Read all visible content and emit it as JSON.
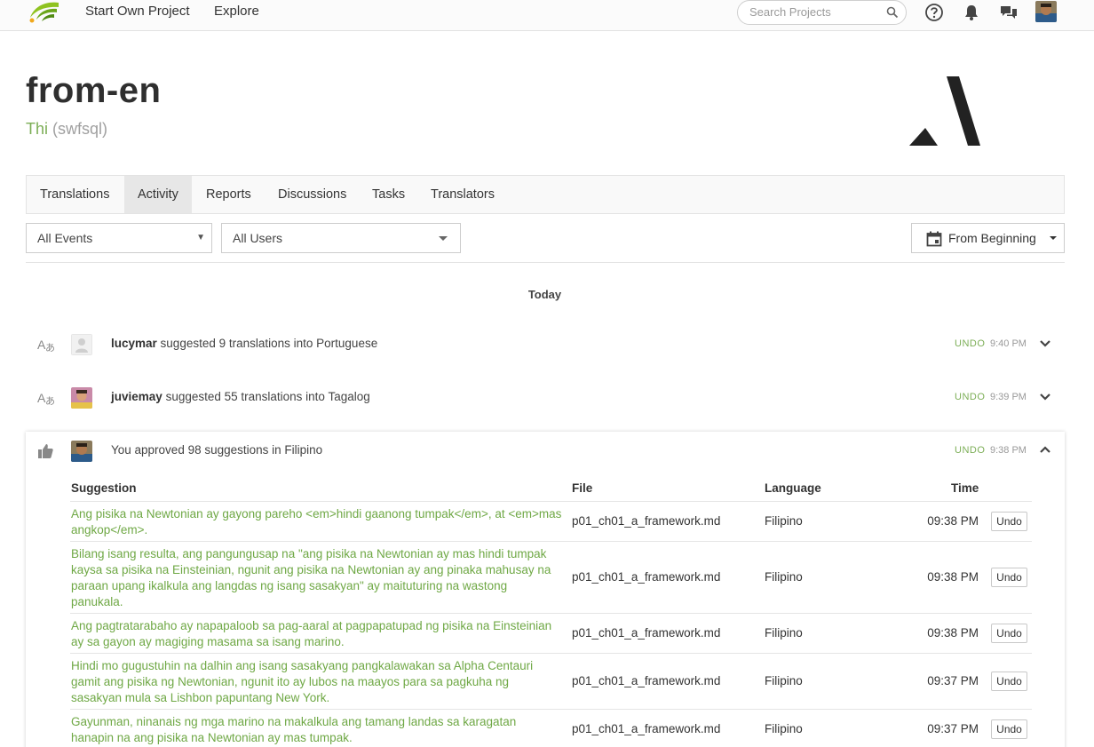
{
  "nav": {
    "links": [
      "Start Own Project",
      "Explore"
    ],
    "search_placeholder": "Search Projects",
    "icons": [
      "help-icon",
      "bell-icon",
      "messages-icon"
    ]
  },
  "project": {
    "title": "from-en",
    "owner_name": "Thi",
    "owner_handle": "(swfsql)"
  },
  "tabs": [
    "Translations",
    "Activity",
    "Reports",
    "Discussions",
    "Tasks",
    "Translators"
  ],
  "active_tab": "Activity",
  "filters": {
    "events": "All Events",
    "users": "All Users",
    "date": "From Beginning"
  },
  "day_label": "Today",
  "events": [
    {
      "user": "lucymar",
      "text": "suggested 9 translations into Portuguese",
      "undo": "UNDO",
      "time": "9:40 PM",
      "icon": "translate-icon"
    },
    {
      "user": "juviemay",
      "text": "suggested 55 translations into Tagalog",
      "undo": "UNDO",
      "time": "9:39 PM",
      "icon": "translate-icon"
    },
    {
      "user": "",
      "text": "You approved 98 suggestions in Filipino",
      "undo": "UNDO",
      "time": "9:38 PM",
      "icon": "thumbs-up-icon"
    }
  ],
  "table": {
    "headers": {
      "suggestion": "Suggestion",
      "file": "File",
      "language": "Language",
      "time": "Time"
    },
    "undo_label": "Undo",
    "rows": [
      {
        "suggestion": "Ang pisika na Newtonian ay gayong pareho <em>hindi gaanong tumpak</em>, at <em>mas angkop</em>.",
        "file": "p01_ch01_a_framework.md",
        "language": "Filipino",
        "time": "09:38 PM"
      },
      {
        "suggestion": "Bilang isang resulta, ang pangungusap na \"ang pisika na Newtonian ay mas hindi tumpak kaysa sa pisika na Einsteinian, ngunit ang pisika na Newtonian ay ang pinaka mahusay na paraan upang ikalkula ang langdas ng isang sasakyan\" ay maituturing na wastong panukala.",
        "file": "p01_ch01_a_framework.md",
        "language": "Filipino",
        "time": "09:38 PM"
      },
      {
        "suggestion": "Ang pagtratarabaho ay napapaloob sa pag-aaral at pagpapatupad ng pisika na Einsteinian ay sa gayon ay magiging masama sa isang marino.",
        "file": "p01_ch01_a_framework.md",
        "language": "Filipino",
        "time": "09:38 PM"
      },
      {
        "suggestion": "Hindi mo gugustuhin na dalhin ang isang sasakyang pangkalawakan sa Alpha Centauri gamit ang pisika ng Newtonian, ngunit ito ay lubos na maayos para sa pagkuha ng sasakyan mula sa Lishbon papuntang New York.",
        "file": "p01_ch01_a_framework.md",
        "language": "Filipino",
        "time": "09:37 PM"
      },
      {
        "suggestion": "Gayunman, ninanais ng mga marino na makalkula ang tamang landas sa karagatan hanapin na ang pisika na Newtonian ay mas tumpak.",
        "file": "p01_ch01_a_framework.md",
        "language": "Filipino",
        "time": "09:37 PM"
      }
    ]
  }
}
